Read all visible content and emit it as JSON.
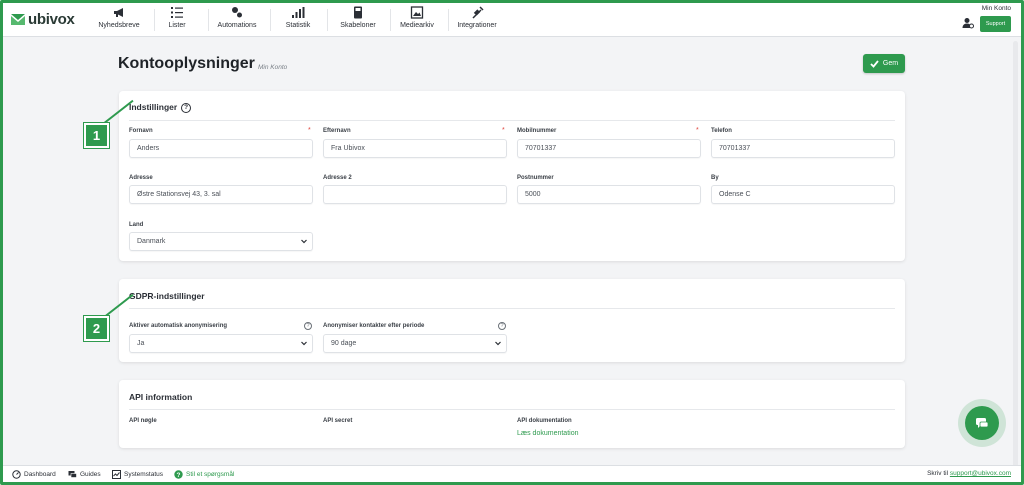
{
  "brand": {
    "name": "ubivox",
    "accent": "#2e9a4e"
  },
  "nav": [
    {
      "label": "Nyhedsbreve",
      "icon": "megaphone-icon"
    },
    {
      "label": "Lister",
      "icon": "list-icon"
    },
    {
      "label": "Automations",
      "icon": "automations-icon"
    },
    {
      "label": "Statistik",
      "icon": "bar-chart-icon"
    },
    {
      "label": "Skabeloner",
      "icon": "template-icon"
    },
    {
      "label": "Mediearkiv",
      "icon": "image-icon"
    },
    {
      "label": "Integrationer",
      "icon": "plug-icon"
    }
  ],
  "topright": {
    "account_label": "Min Konto",
    "support_label": "Support"
  },
  "page": {
    "title": "Kontooplysninger",
    "subtitle": "Min Konto",
    "save_label": "Gem"
  },
  "settings": {
    "title": "Indstillinger",
    "fields": {
      "fornavn": {
        "label": "Fornavn",
        "value": "Anders",
        "required": "*"
      },
      "efternavn": {
        "label": "Efternavn",
        "value": "Fra Ubivox",
        "required": "*"
      },
      "mobil": {
        "label": "Mobilnummer",
        "value": "70701337",
        "required": "*"
      },
      "telefon": {
        "label": "Telefon",
        "value": "70701337"
      },
      "adresse": {
        "label": "Adresse",
        "value": "Østre Stationsvej 43, 3. sal"
      },
      "adresse2": {
        "label": "Adresse 2",
        "value": ""
      },
      "postnummer": {
        "label": "Postnummer",
        "value": "5000"
      },
      "by": {
        "label": "By",
        "value": "Odense C"
      },
      "land": {
        "label": "Land",
        "value": "Danmark"
      }
    }
  },
  "gdpr": {
    "title": "GDPR-indstillinger",
    "auto_anon": {
      "label": "Aktiver automatisk anonymisering",
      "value": "Ja"
    },
    "anon_period": {
      "label": "Anonymiser kontakter efter periode",
      "value": "90 dage"
    }
  },
  "api": {
    "title": "API information",
    "key_label": "API nøgle",
    "secret_label": "API secret",
    "docs_label": "API dokumentation",
    "docs_link": "Læs dokumentation"
  },
  "callouts": [
    "1",
    "2"
  ],
  "footer": {
    "items": [
      {
        "label": "Dashboard",
        "icon": "dashboard-icon"
      },
      {
        "label": "Guides",
        "icon": "chat-icon"
      },
      {
        "label": "Systemstatus",
        "icon": "status-icon"
      },
      {
        "label": "Stil et spørgsmål",
        "icon": "question-icon"
      }
    ],
    "write_to": "Skriv til",
    "email": "support@ubivox.com"
  }
}
